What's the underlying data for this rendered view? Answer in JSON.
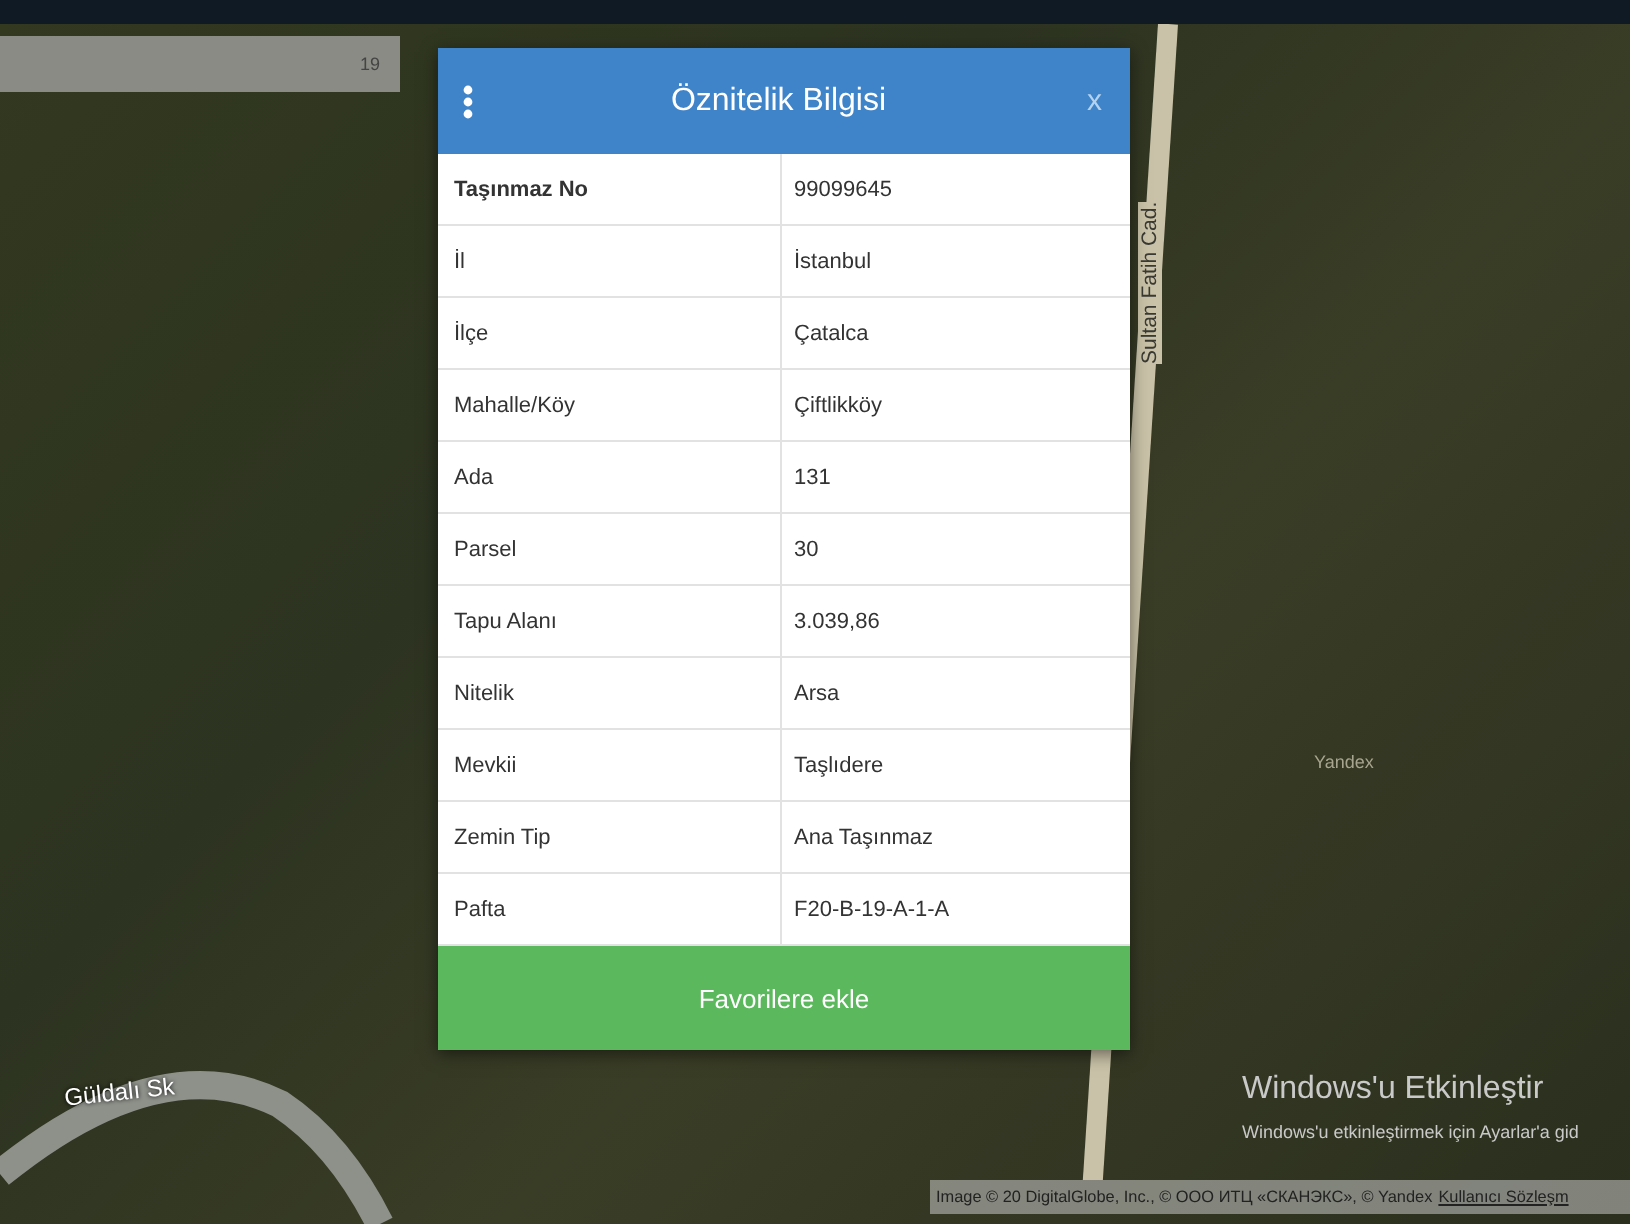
{
  "map": {
    "zoom_level": "19",
    "street_labels": [
      {
        "kind": "vertical",
        "text": "Sultan Fatih Cad."
      },
      {
        "kind": "curved",
        "text": "Güldalı Sk"
      }
    ],
    "provider_mark": "Yandex",
    "attribution": {
      "text": "Image © 20",
      "rest": "DigitalGlobe, Inc., © ООО ИТЦ «СКАНЭКС», © Yandex",
      "link": "Kullanıcı Sözleşm"
    }
  },
  "dialog": {
    "title": "Öznitelik Bilgisi",
    "close": "x",
    "rows": [
      {
        "label": "Taşınmaz No",
        "value": "99099645",
        "bold": true
      },
      {
        "label": "İl",
        "value": "İstanbul",
        "bold": false
      },
      {
        "label": "İlçe",
        "value": "Çatalca",
        "bold": false
      },
      {
        "label": "Mahalle/Köy",
        "value": "Çiftlikköy",
        "bold": false
      },
      {
        "label": "Ada",
        "value": "131",
        "bold": false
      },
      {
        "label": "Parsel",
        "value": "30",
        "bold": false
      },
      {
        "label": "Tapu Alanı",
        "value": "3.039,86",
        "bold": false
      },
      {
        "label": "Nitelik",
        "value": "Arsa",
        "bold": false
      },
      {
        "label": "Mevkii",
        "value": "Taşlıdere",
        "bold": false
      },
      {
        "label": "Zemin Tip",
        "value": "Ana Taşınmaz",
        "bold": false
      },
      {
        "label": "Pafta",
        "value": "F20-B-19-A-1-A",
        "bold": false
      }
    ],
    "button": "Favorilere ekle"
  },
  "activation": {
    "title": "Windows'u Etkinleştir",
    "message": "Windows'u etkinleştirmek için Ayarlar'a gid"
  }
}
